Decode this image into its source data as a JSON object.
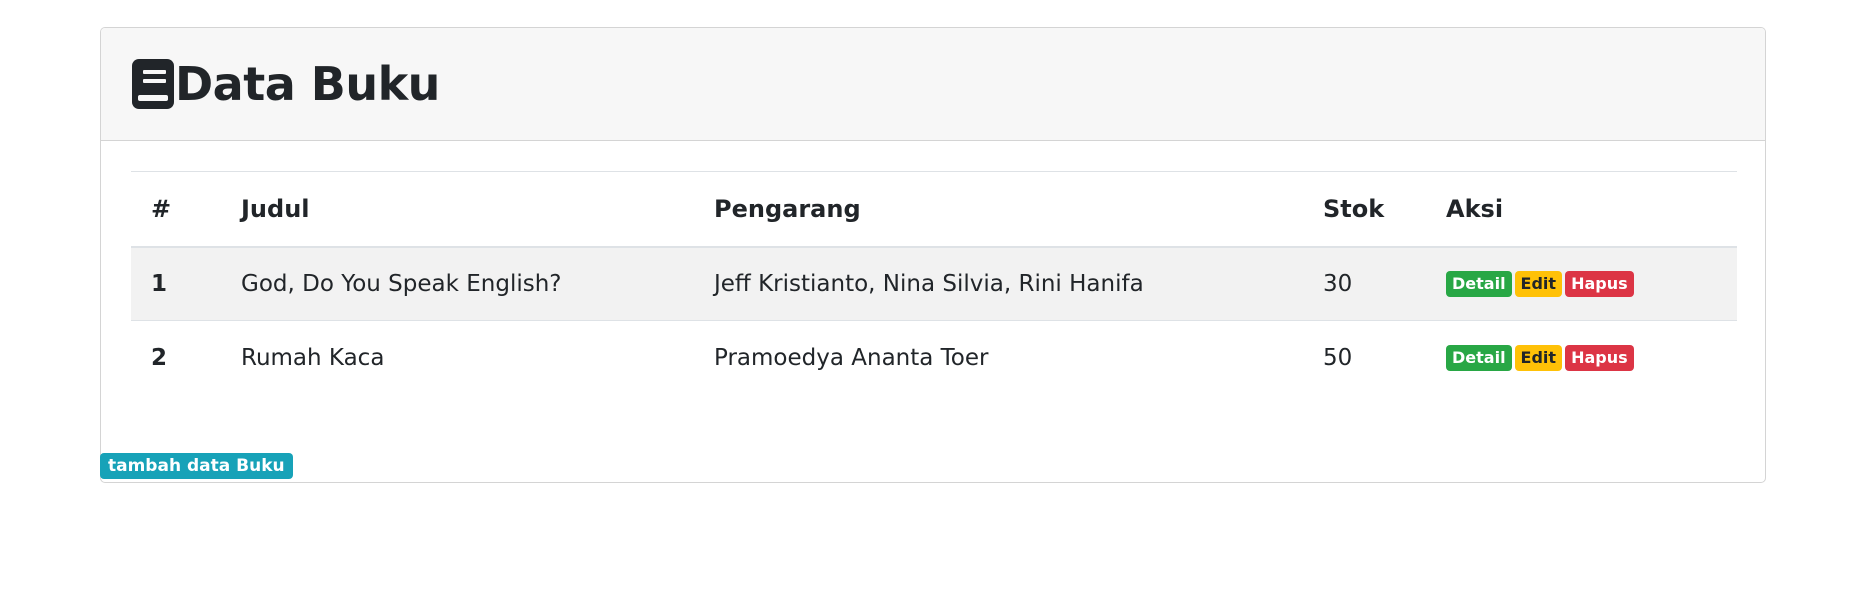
{
  "header": {
    "icon": "book-icon",
    "title": "Data Buku"
  },
  "table": {
    "columns": [
      "#",
      "Judul",
      "Pengarang",
      "Stok",
      "Aksi"
    ],
    "rows": [
      {
        "no": "1",
        "judul": "God, Do You Speak English?",
        "pengarang": "Jeff Kristianto, Nina Silvia, Rini Hanifa",
        "stok": "30"
      },
      {
        "no": "2",
        "judul": "Rumah Kaca",
        "pengarang": "Pramoedya Ananta Toer",
        "stok": "50"
      }
    ],
    "actions": {
      "detail": "Detail",
      "edit": "Edit",
      "hapus": "Hapus"
    }
  },
  "add_button": "tambah data Buku",
  "colors": {
    "success": "#28a745",
    "warning": "#ffc107",
    "danger": "#dc3545",
    "info": "#17a2b8"
  }
}
